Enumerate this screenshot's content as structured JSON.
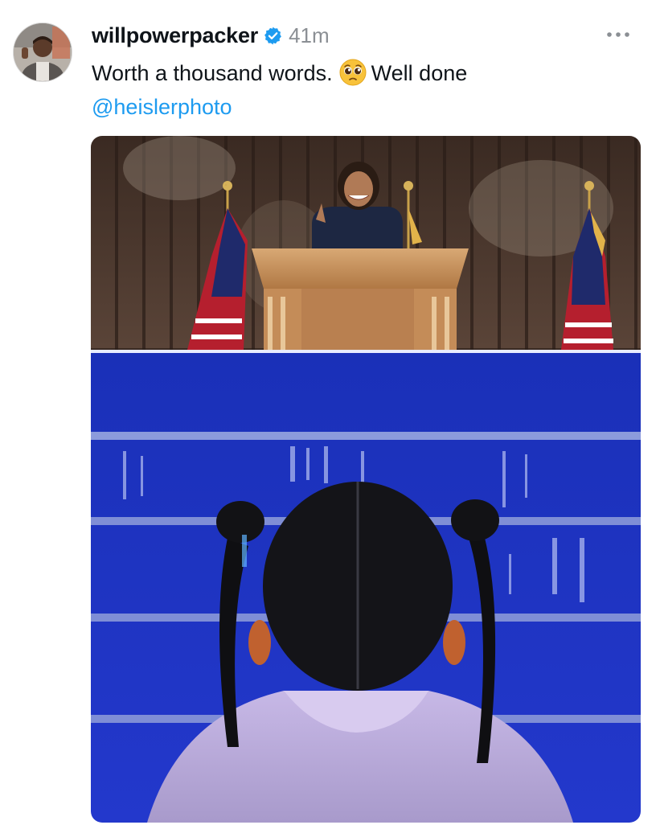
{
  "post": {
    "username": "willpowerpacker",
    "timestamp": "41m",
    "text_before_emoji": "Worth a thousand words.",
    "emoji_icon": "pleading-face-emoji",
    "text_after_emoji": "Well done",
    "mention": "@heislerphoto",
    "verified_icon": "verified-badge-icon",
    "more_icon": "ellipsis-icon"
  },
  "colors": {
    "mention": "#1d9bf0",
    "verified": "#1d9bf0",
    "timestamp": "#8b8f94",
    "stage_blue": "#1e34c8"
  }
}
